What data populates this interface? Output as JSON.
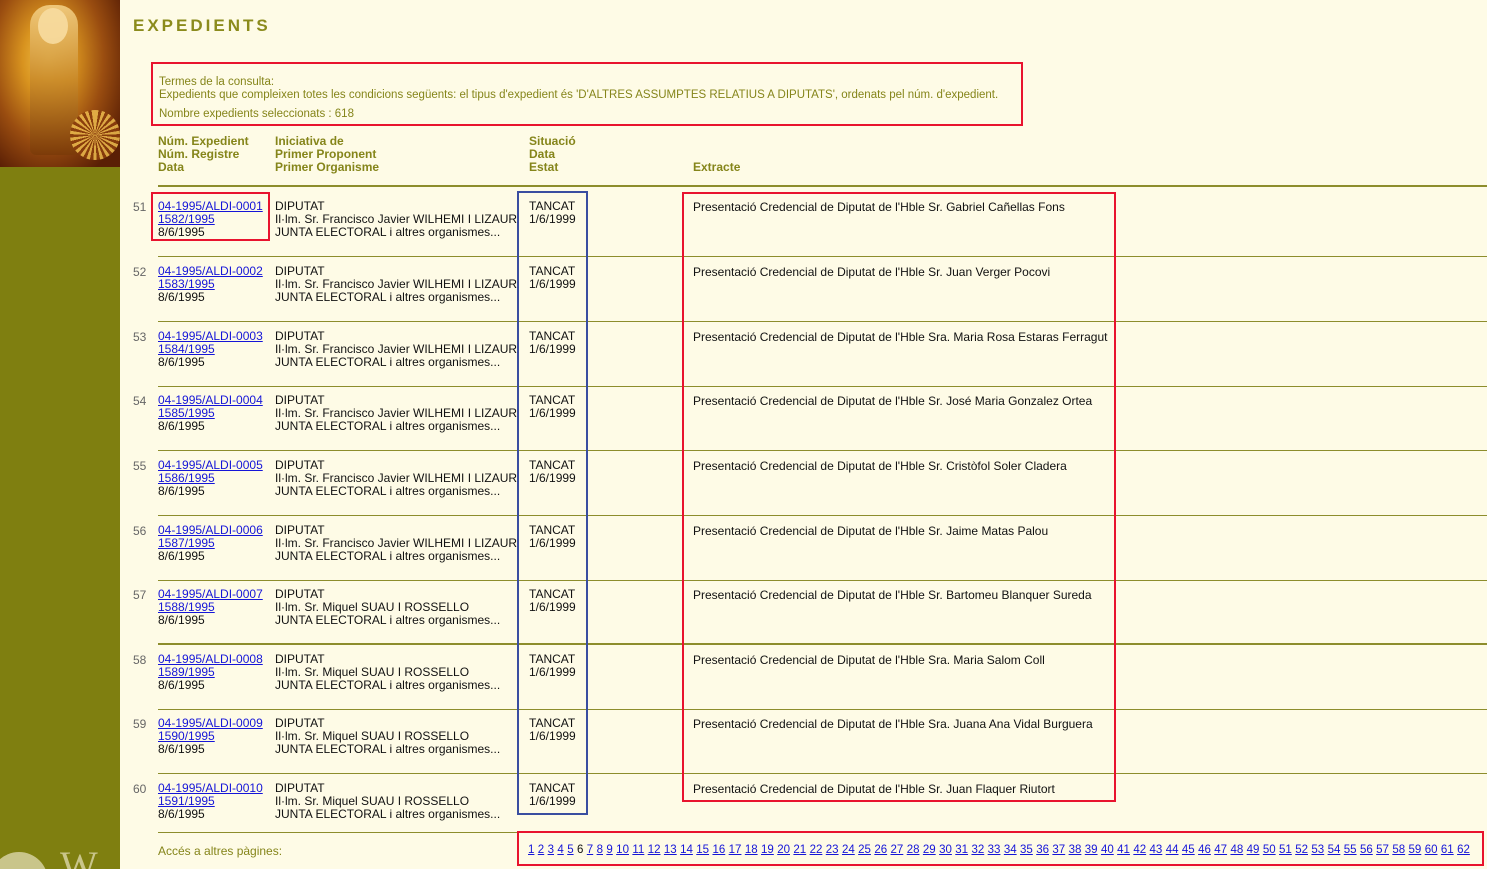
{
  "page": {
    "title": "EXPEDIENTS"
  },
  "query": {
    "heading": "Termes de la consulta:",
    "description": "Expedients que compleixen totes les condicions següents: el tipus d'expedient és 'D'ALTRES ASSUMPTES RELATIUS A DIPUTATS', ordenats pel núm. d'expedient.",
    "count": "Nombre expedients seleccionats : 618"
  },
  "headers": {
    "col1": [
      "Núm. Expedient",
      "Núm. Registre",
      "Data"
    ],
    "col2": [
      "Iniciativa de",
      "Primer Proponent",
      "Primer Organisme"
    ],
    "col3": [
      "Situació",
      "Data",
      "Estat"
    ],
    "col4": "Extracte"
  },
  "rows": [
    {
      "num": "51",
      "expedient": "04-1995/ALDI-0001",
      "registre": "1582/1995",
      "data": "8/6/1995",
      "iniciativa": "DIPUTAT",
      "proponent": "Il·lm. Sr. Francisco Javier WILHEMI I LIZAUR",
      "organisme": "JUNTA ELECTORAL i altres organismes...",
      "situacio": "TANCAT",
      "situacio_data": "1/6/1999",
      "extracte": "Presentació Credencial de Diputat de l'Hble Sr. Gabriel Cañellas Fons"
    },
    {
      "num": "52",
      "expedient": "04-1995/ALDI-0002",
      "registre": "1583/1995",
      "data": "8/6/1995",
      "iniciativa": "DIPUTAT",
      "proponent": "Il·lm. Sr. Francisco Javier WILHEMI I LIZAUR",
      "organisme": "JUNTA ELECTORAL i altres organismes...",
      "situacio": "TANCAT",
      "situacio_data": "1/6/1999",
      "extracte": "Presentació Credencial de Diputat de l'Hble Sr. Juan Verger Pocovi"
    },
    {
      "num": "53",
      "expedient": "04-1995/ALDI-0003",
      "registre": "1584/1995",
      "data": "8/6/1995",
      "iniciativa": "DIPUTAT",
      "proponent": "Il·lm. Sr. Francisco Javier WILHEMI I LIZAUR",
      "organisme": "JUNTA ELECTORAL i altres organismes...",
      "situacio": "TANCAT",
      "situacio_data": "1/6/1999",
      "extracte": "Presentació Credencial de Diputat de l'Hble Sra. Maria Rosa Estaras Ferragut"
    },
    {
      "num": "54",
      "expedient": "04-1995/ALDI-0004",
      "registre": "1585/1995",
      "data": "8/6/1995",
      "iniciativa": "DIPUTAT",
      "proponent": "Il·lm. Sr. Francisco Javier WILHEMI I LIZAUR",
      "organisme": "JUNTA ELECTORAL i altres organismes...",
      "situacio": "TANCAT",
      "situacio_data": "1/6/1999",
      "extracte": "Presentació Credencial de Diputat de l'Hble Sr. José Maria Gonzalez Ortea"
    },
    {
      "num": "55",
      "expedient": "04-1995/ALDI-0005",
      "registre": "1586/1995",
      "data": "8/6/1995",
      "iniciativa": "DIPUTAT",
      "proponent": "Il·lm. Sr. Francisco Javier WILHEMI I LIZAUR",
      "organisme": "JUNTA ELECTORAL i altres organismes...",
      "situacio": "TANCAT",
      "situacio_data": "1/6/1999",
      "extracte": "Presentació Credencial de Diputat de l'Hble Sr. Cristòfol Soler Cladera"
    },
    {
      "num": "56",
      "expedient": "04-1995/ALDI-0006",
      "registre": "1587/1995",
      "data": "8/6/1995",
      "iniciativa": "DIPUTAT",
      "proponent": "Il·lm. Sr. Francisco Javier WILHEMI I LIZAUR",
      "organisme": "JUNTA ELECTORAL i altres organismes...",
      "situacio": "TANCAT",
      "situacio_data": "1/6/1999",
      "extracte": "Presentació Credencial de Diputat de l'Hble Sr. Jaime Matas Palou"
    },
    {
      "num": "57",
      "expedient": "04-1995/ALDI-0007",
      "registre": "1588/1995",
      "data": "8/6/1995",
      "iniciativa": "DIPUTAT",
      "proponent": "Il·lm. Sr. Miquel SUAU I ROSSELLO",
      "organisme": "JUNTA ELECTORAL i altres organismes...",
      "situacio": "TANCAT",
      "situacio_data": "1/6/1999",
      "extracte": "Presentació Credencial de Diputat de l'Hble Sr. Bartomeu Blanquer Sureda"
    },
    {
      "num": "58",
      "expedient": "04-1995/ALDI-0008",
      "registre": "1589/1995",
      "data": "8/6/1995",
      "iniciativa": "DIPUTAT",
      "proponent": "Il·lm. Sr. Miquel SUAU I ROSSELLO",
      "organisme": "JUNTA ELECTORAL i altres organismes...",
      "situacio": "TANCAT",
      "situacio_data": "1/6/1999",
      "extracte": "Presentació Credencial de Diputat de l'Hble Sra. Maria Salom Coll"
    },
    {
      "num": "59",
      "expedient": "04-1995/ALDI-0009",
      "registre": "1590/1995",
      "data": "8/6/1995",
      "iniciativa": "DIPUTAT",
      "proponent": "Il·lm. Sr. Miquel SUAU I ROSSELLO",
      "organisme": "JUNTA ELECTORAL i altres organismes...",
      "situacio": "TANCAT",
      "situacio_data": "1/6/1999",
      "extracte": "Presentació Credencial de Diputat de l'Hble Sra. Juana Ana Vidal Burguera"
    },
    {
      "num": "60",
      "expedient": "04-1995/ALDI-0010",
      "registre": "1591/1995",
      "data": "8/6/1995",
      "iniciativa": "DIPUTAT",
      "proponent": "Il·lm. Sr. Miquel SUAU I ROSSELLO",
      "organisme": "JUNTA ELECTORAL i altres organismes...",
      "situacio": "TANCAT",
      "situacio_data": "1/6/1999",
      "extracte": "Presentació Credencial de Diputat de l'Hble Sr. Juan Flaquer Riutort"
    }
  ],
  "pagination": {
    "label": "Accés a altres pàgines:",
    "current": "6",
    "pages": [
      "1",
      "2",
      "3",
      "4",
      "5",
      "6",
      "7",
      "8",
      "9",
      "10",
      "11",
      "12",
      "13",
      "14",
      "15",
      "16",
      "17",
      "18",
      "19",
      "20",
      "21",
      "22",
      "23",
      "24",
      "25",
      "26",
      "27",
      "28",
      "29",
      "30",
      "31",
      "32",
      "33",
      "34",
      "35",
      "36",
      "37",
      "38",
      "39",
      "40",
      "41",
      "42",
      "43",
      "44",
      "45",
      "46",
      "47",
      "48",
      "49",
      "50",
      "51",
      "52",
      "53",
      "54",
      "55",
      "56",
      "57",
      "58",
      "59",
      "60",
      "61",
      "62"
    ]
  }
}
